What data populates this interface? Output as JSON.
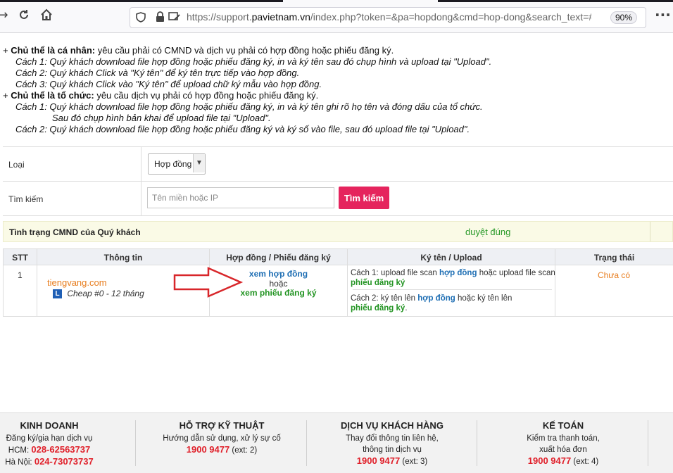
{
  "browser": {
    "url_prefix": "https://support.",
    "url_domain": "pavietnam.vn",
    "url_rest": "/index.php?token=&pa=hopdong&cmd=hop-dong&search_text=#s",
    "zoom": "90%"
  },
  "instructions": {
    "personal_title": "Chủ thể là cá nhân:",
    "personal_desc": "yêu cầu phải có CMND và dịch vụ phải có hợp đồng hoặc phiếu đăng ký.",
    "personal_steps": [
      "Cách 1: Quý khách download file hợp đồng hoặc phiếu đăng ký, in và ký tên sau đó chụp hình và upload tại \"Upload\".",
      "Cách 2: Quý khách Click và \"Ký tên\" để ký tên trực tiếp vào hợp đồng.",
      "Cách 3: Quý khách Click vào \"Ký tên\" để upload chữ ký mẫu vào hợp đồng."
    ],
    "org_title": "Chủ thể là tổ chức:",
    "org_desc": "yêu cầu dịch vụ phải có hợp đồng hoặc phiếu đăng ký.",
    "org_steps": [
      "Cách 1: Quý khách download file hợp đồng hoặc phiếu đăng ký, in và ký tên ghi rõ họ tên và đóng dấu của tổ chức.",
      "Sau đó chụp hình bản khai để upload file tại \"Upload\".",
      "Cách 2: Quý khách download file hợp đồng hoặc phiếu đăng ký và ký số vào file, sau đó upload file tại \"Upload\"."
    ]
  },
  "form": {
    "type_label": "Loại",
    "type_value": "Hợp đồng",
    "search_label": "Tìm kiếm",
    "search_placeholder": "Tên miền hoặc IP",
    "search_button": "Tìm kiếm"
  },
  "status": {
    "label": "Tình trạng CMND của Quý khách",
    "value": "duyệt đúng"
  },
  "table": {
    "headers": [
      "STT",
      "Thông tin",
      "Hợp đồng / Phiếu đăng ký",
      "Ký tên / Upload",
      "Trạng thái"
    ],
    "rows": [
      {
        "stt": "1",
        "domain": "tiengvang.com",
        "badge": "L",
        "plan": "Cheap #0 - 12 tháng",
        "view_contract": "xem hợp đồng",
        "or": "hoặc",
        "view_form": "xem phiếu đăng ký",
        "method1_prefix": "Cách 1: upload file scan",
        "method1_link1": "hợp đồng",
        "method1_mid": "hoặc upload file scan",
        "method1_link2": "phiếu đăng ký",
        "method2_prefix": "Cách 2: ký tên lên",
        "method2_link1": "hợp đồng",
        "method2_mid": "hoặc ký tên lên",
        "method2_link2": "phiếu đăng ký",
        "method2_end": ".",
        "status": "Chưa có"
      }
    ]
  },
  "footer": {
    "sales": {
      "title": "KINH DOANH",
      "desc": "Đăng ký/gia hạn dịch vụ",
      "hcm_label": "HCM:",
      "hcm_phone": "028-62563737",
      "hn_label": "Hà Nội:",
      "hn_phone": "024-73073737"
    },
    "support": {
      "title": "HỖ TRỢ KỸ THUẬT",
      "desc": "Hướng dẫn sử dụng, xử lý sự cố",
      "phone": "1900 9477",
      "ext": "(ext: 2)"
    },
    "customer": {
      "title": "DỊCH VỤ KHÁCH HÀNG",
      "desc1": "Thay đổi thông tin liên hệ,",
      "desc2": "thông tin dịch vụ",
      "phone": "1900 9477",
      "ext": "(ext: 3)"
    },
    "accounting": {
      "title": "KẾ TOÁN",
      "desc1": "Kiểm tra thanh toán,",
      "desc2": "xuất hóa đơn",
      "phone": "1900 9477",
      "ext": "(ext: 4)"
    }
  }
}
